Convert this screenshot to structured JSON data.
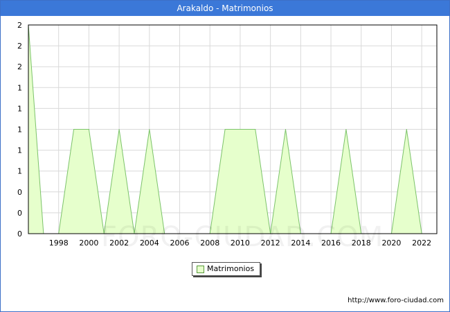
{
  "header": {
    "title": "Arakaldo - Matrimonios"
  },
  "legend": {
    "label": "Matrimonios"
  },
  "footer": {
    "url": "http://www.foro-ciudad.com"
  },
  "watermark": "FORO-CIUDAD.COM",
  "colors": {
    "title_bg": "#3b78d8",
    "area_fill": "#e6ffcc",
    "area_line": "#7cc36a",
    "grid": "#d9d9d9"
  },
  "chart_data": {
    "type": "area",
    "title": "Arakaldo - Matrimonios",
    "x": [
      1996,
      1997,
      1998,
      1999,
      2000,
      2001,
      2002,
      2003,
      2004,
      2005,
      2006,
      2007,
      2008,
      2009,
      2010,
      2011,
      2012,
      2013,
      2014,
      2015,
      2016,
      2017,
      2018,
      2019,
      2020,
      2021,
      2022
    ],
    "series": [
      {
        "name": "Matrimonios",
        "values": [
          2,
          0,
          0,
          1,
          1,
          0,
          1,
          0,
          1,
          0,
          0,
          0,
          0,
          1,
          1,
          1,
          0,
          1,
          0,
          0,
          0,
          1,
          0,
          0,
          0,
          1,
          0
        ]
      }
    ],
    "xlim": [
      1996,
      2023
    ],
    "ylim": [
      0,
      2
    ],
    "x_ticks": [
      "1998",
      "2000",
      "2002",
      "2004",
      "2006",
      "2008",
      "2010",
      "2012",
      "2014",
      "2016",
      "2018",
      "2020",
      "2022"
    ],
    "y_ticks": [
      "0",
      "0",
      "0",
      "1",
      "1",
      "1",
      "1",
      "1",
      "2",
      "2",
      "2"
    ],
    "grid": true,
    "legend_position": "bottom-center"
  }
}
